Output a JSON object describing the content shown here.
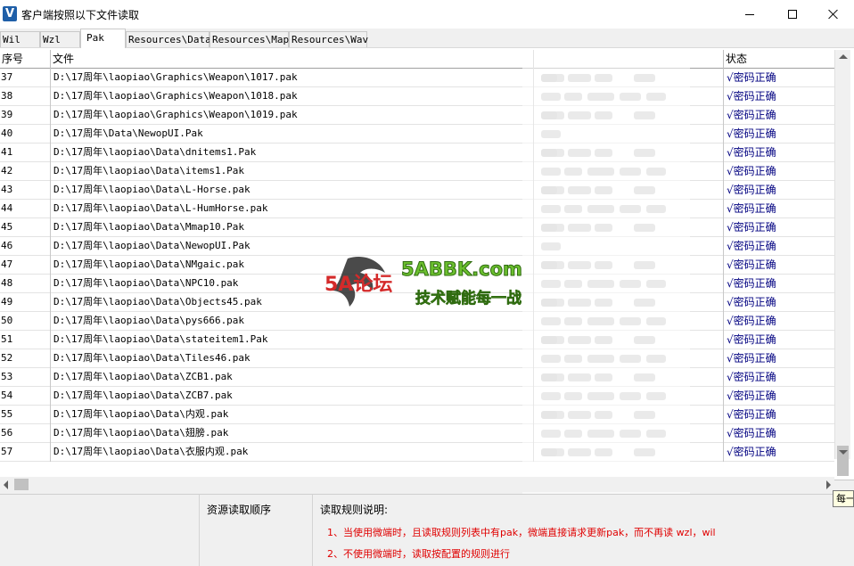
{
  "window": {
    "app_icon_letter": "V",
    "title": "客户端按照以下文件读取"
  },
  "tabs": [
    {
      "label": "Wil",
      "active": false
    },
    {
      "label": "Wzl",
      "active": false
    },
    {
      "label": "Pak",
      "active": true
    },
    {
      "label": "Resources\\Data",
      "active": false
    },
    {
      "label": "Resources\\Map",
      "active": false
    },
    {
      "label": "Resources\\Wav",
      "active": false
    }
  ],
  "grid": {
    "columns": {
      "index": "序号",
      "file": "文件",
      "status": "状态"
    },
    "rows": [
      {
        "index": "37",
        "file": "D:\\17周年\\laopiao\\Graphics\\Weapon\\1017.pak",
        "status": "√密码正确"
      },
      {
        "index": "38",
        "file": "D:\\17周年\\laopiao\\Graphics\\Weapon\\1018.pak",
        "status": "√密码正确"
      },
      {
        "index": "39",
        "file": "D:\\17周年\\laopiao\\Graphics\\Weapon\\1019.pak",
        "status": "√密码正确"
      },
      {
        "index": "40",
        "file": "D:\\17周年\\Data\\NewopUI.Pak",
        "status": "√密码正确"
      },
      {
        "index": "41",
        "file": "D:\\17周年\\laopiao\\Data\\dnitems1.Pak",
        "status": "√密码正确"
      },
      {
        "index": "42",
        "file": "D:\\17周年\\laopiao\\Data\\items1.Pak",
        "status": "√密码正确"
      },
      {
        "index": "43",
        "file": "D:\\17周年\\laopiao\\Data\\L-Horse.pak",
        "status": "√密码正确"
      },
      {
        "index": "44",
        "file": "D:\\17周年\\laopiao\\Data\\L-HumHorse.pak",
        "status": "√密码正确"
      },
      {
        "index": "45",
        "file": "D:\\17周年\\laopiao\\Data\\Mmap10.Pak",
        "status": "√密码正确"
      },
      {
        "index": "46",
        "file": "D:\\17周年\\laopiao\\Data\\NewopUI.Pak",
        "status": "√密码正确"
      },
      {
        "index": "47",
        "file": "D:\\17周年\\laopiao\\Data\\NMgaic.pak",
        "status": "√密码正确"
      },
      {
        "index": "48",
        "file": "D:\\17周年\\laopiao\\Data\\NPC10.pak",
        "status": "√密码正确"
      },
      {
        "index": "49",
        "file": "D:\\17周年\\laopiao\\Data\\Objects45.pak",
        "status": "√密码正确"
      },
      {
        "index": "50",
        "file": "D:\\17周年\\laopiao\\Data\\pys666.pak",
        "status": "√密码正确"
      },
      {
        "index": "51",
        "file": "D:\\17周年\\laopiao\\Data\\stateitem1.Pak",
        "status": "√密码正确"
      },
      {
        "index": "52",
        "file": "D:\\17周年\\laopiao\\Data\\Tiles46.pak",
        "status": "√密码正确"
      },
      {
        "index": "53",
        "file": "D:\\17周年\\laopiao\\Data\\ZCB1.pak",
        "status": "√密码正确"
      },
      {
        "index": "54",
        "file": "D:\\17周年\\laopiao\\Data\\ZCB7.pak",
        "status": "√密码正确"
      },
      {
        "index": "55",
        "file": "D:\\17周年\\laopiao\\Data\\内观.pak",
        "status": "√密码正确"
      },
      {
        "index": "56",
        "file": "D:\\17周年\\laopiao\\Data\\翅膀.pak",
        "status": "√密码正确"
      },
      {
        "index": "57",
        "file": "D:\\17周年\\laopiao\\Data\\衣服内观.pak",
        "status": "√密码正确"
      }
    ]
  },
  "panels": {
    "order_title": "资源读取顺序",
    "rules_title": "读取规则说明:",
    "rules": [
      "1、当使用微端时，且读取规则列表中有pak，微端直接请求更新pak，而不再读 wzl，wil",
      "2、不使用微端时，读取按配置的规则进行"
    ]
  },
  "tooltip": "每一",
  "watermark": {
    "logo_text": "5A论坛",
    "domain": "5ABBK.com",
    "slogan": "技术赋能每一战"
  },
  "colors": {
    "status_text": "#000080",
    "rule_text": "#e00000",
    "watermark_green": "#6bbf2e"
  }
}
